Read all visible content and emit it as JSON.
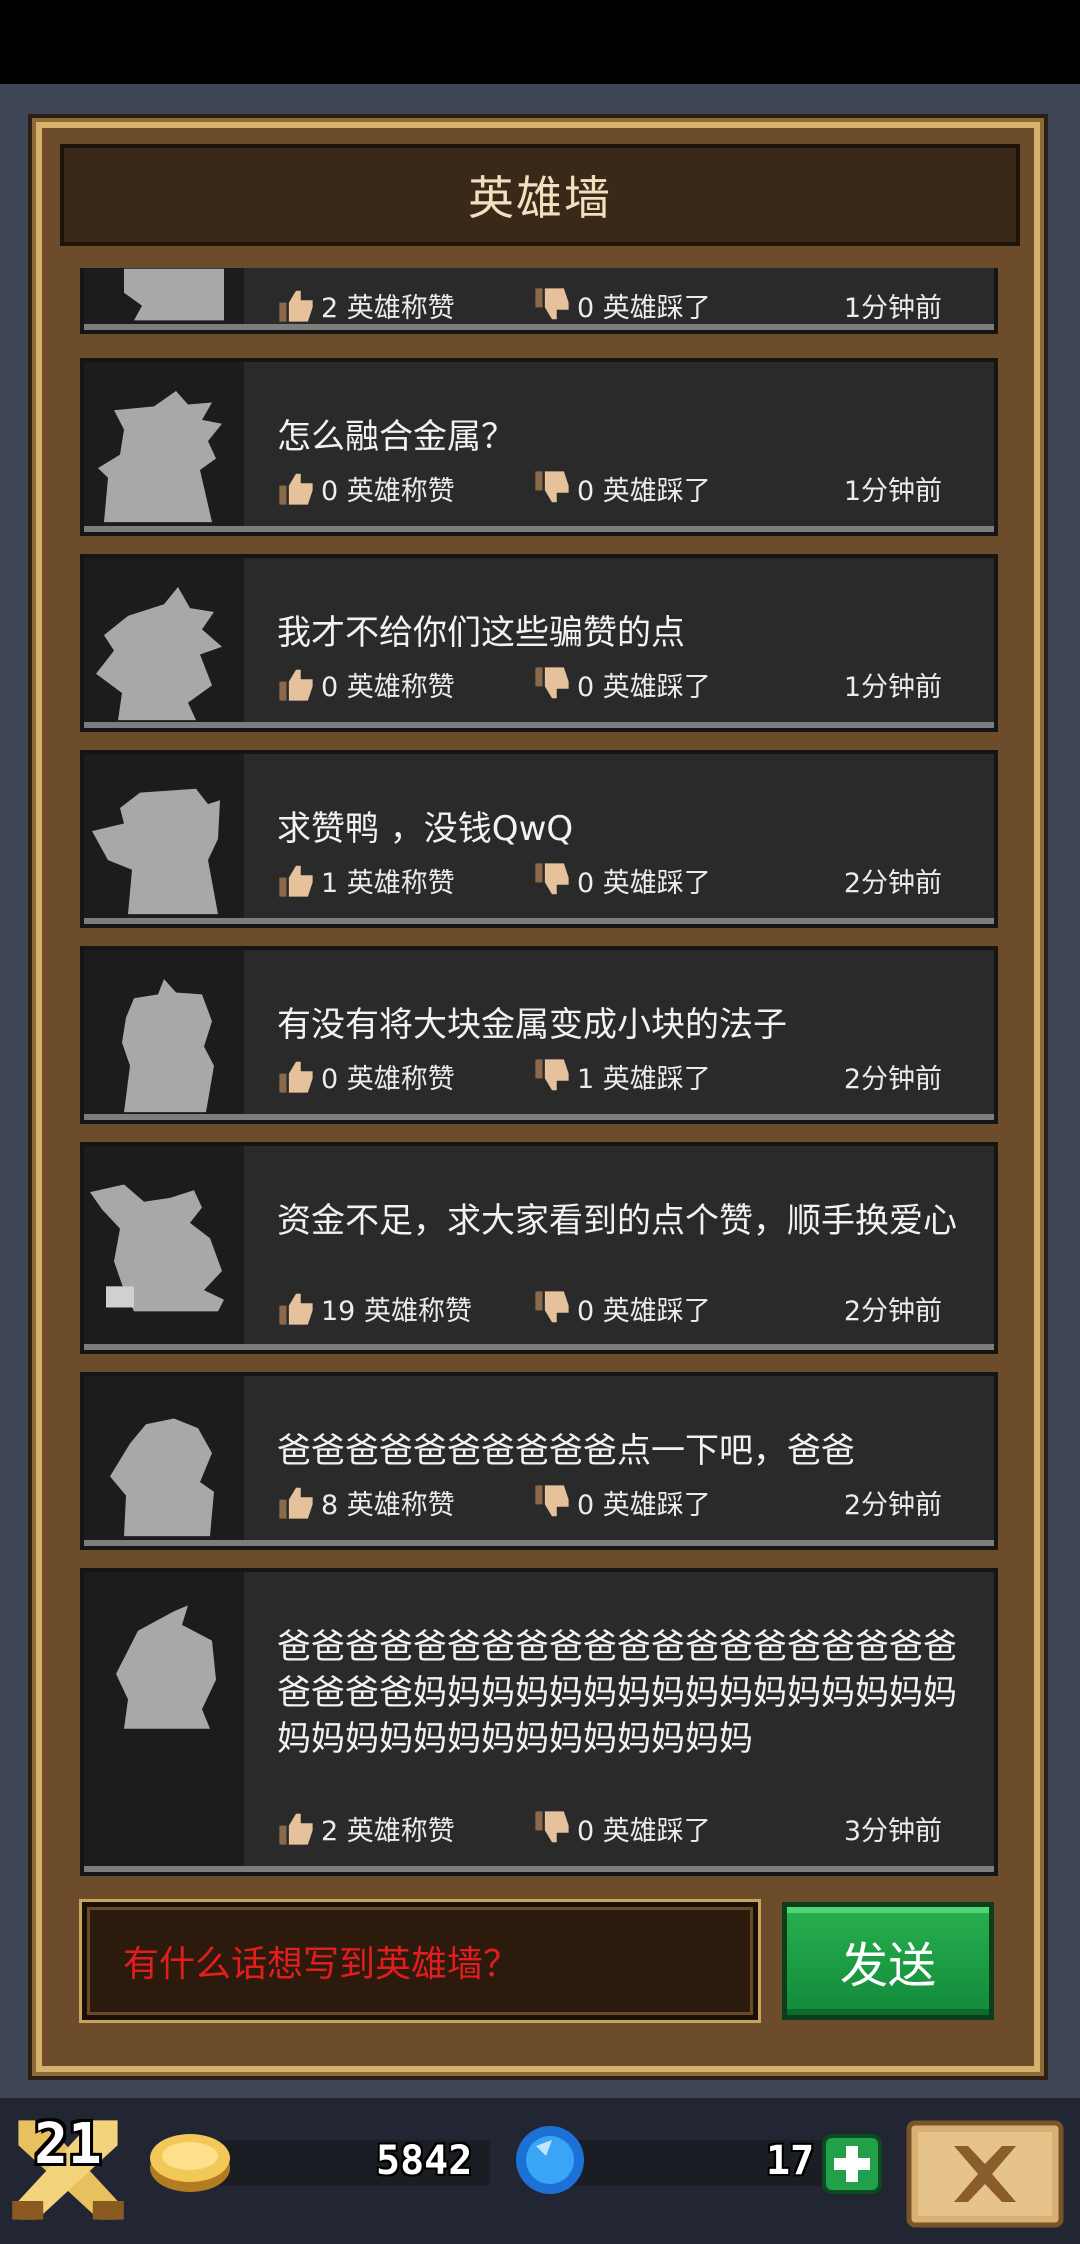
{
  "title": "英雄墙",
  "posts": [
    {
      "message": "",
      "likes": "2 英雄称赞",
      "dislikes": "0 英雄踩了",
      "time": "1分钟前"
    },
    {
      "message": "怎么融合金属？",
      "likes": "0 英雄称赞",
      "dislikes": "0 英雄踩了",
      "time": "1分钟前"
    },
    {
      "message": "我才不给你们这些骗赞的点",
      "likes": "0 英雄称赞",
      "dislikes": "0 英雄踩了",
      "time": "1分钟前"
    },
    {
      "message": "求赞鸭 ，没钱QwQ",
      "likes": "1 英雄称赞",
      "dislikes": "0 英雄踩了",
      "time": "2分钟前"
    },
    {
      "message": "有没有将大块金属变成小块的法子",
      "likes": "0 英雄称赞",
      "dislikes": "1 英雄踩了",
      "time": "2分钟前"
    },
    {
      "message": "资金不足，求大家看到的点个赞，顺手换爱心",
      "likes": "19 英雄称赞",
      "dislikes": "0 英雄踩了",
      "time": "2分钟前"
    },
    {
      "message": "爸爸爸爸爸爸爸爸爸爸点一下吧，爸爸",
      "likes": "8 英雄称赞",
      "dislikes": "0 英雄踩了",
      "time": "2分钟前"
    },
    {
      "message": "爸爸爸爸爸爸爸爸爸爸爸爸爸爸爸爸爸爸爸爸爸爸爸爸妈妈妈妈妈妈妈妈妈妈妈妈妈妈妈妈妈妈妈妈妈妈妈妈妈妈妈妈妈妈",
      "likes": "2 英雄称赞",
      "dislikes": "0 英雄踩了",
      "time": "3分钟前"
    }
  ],
  "input": {
    "placeholder": "有什么话想写到英雄墙？"
  },
  "send_label": "发送",
  "hud": {
    "level": "21",
    "coins": "5842",
    "gems": "17"
  },
  "colors": {
    "frame": "#6c4c2b",
    "card": "#2a2a2a",
    "send": "#1f9e47",
    "placeholder": "#e21d1d"
  }
}
